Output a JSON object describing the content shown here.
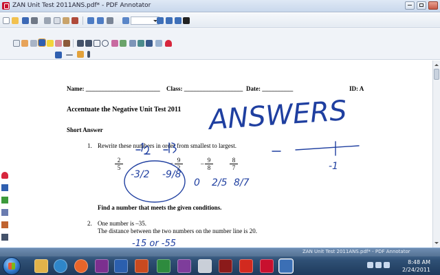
{
  "window": {
    "title": "ZAN Unit Test 2011ANS.pdf* - PDF Annotator"
  },
  "toolbars": {
    "row1_icons": [
      "new-icon",
      "open-icon",
      "save-icon",
      "print-icon",
      "cut-icon",
      "copy-icon",
      "paste-icon",
      "delete-icon",
      "undo-icon",
      "redo-icon",
      "find-icon",
      "zoom-select",
      "page-first-icon",
      "page-prev-icon",
      "page-next-icon",
      "page-last-icon"
    ],
    "row2_icons": [
      "select-icon",
      "hand-icon",
      "zoom-icon",
      "pen-icon",
      "highlighter-icon",
      "eraser-icon",
      "text-icon",
      "stamp-icon",
      "line-icon",
      "arrow-icon",
      "rectangle-icon",
      "ellipse-icon",
      "marker-icon",
      "comment-icon",
      "image-icon",
      "shape-icon",
      "cross-icon",
      "grid-icon",
      "heart-icon"
    ]
  },
  "document": {
    "name_label": "Name: ________________________",
    "class_label": "Class: ___________________",
    "date_label": "Date: __________",
    "id_label": "ID: A",
    "test_title": "Accentuate the Negative Unit Test 2011",
    "section": "Short Answer",
    "q1_num": "1.",
    "q1_text": "Rewrite these numbers in order from smallest to largest.",
    "q1_fractions": [
      {
        "num": "2",
        "den": "5"
      },
      {
        "num": "9",
        "den": "2",
        "neg": true
      },
      {
        "num": "9",
        "den": "8",
        "neg": true
      },
      {
        "num": "8",
        "den": "7"
      }
    ],
    "find_text": "Find a number that meets the given conditions.",
    "q2_num": "2.",
    "q2_line1": "One number is –35.",
    "q2_line2": "The distance between the two numbers on the number line is 20."
  },
  "annotations": {
    "answers_word": "ANSWERS",
    "ordered_list": [
      "-3/2",
      "-9/8",
      "0",
      "2/5",
      "8/7"
    ],
    "numberline_label": "-1",
    "q2_answer": "-15  or  -55"
  },
  "taskbar": {
    "tab_label": "ZAN Unit Test 2011ANS.pdf* - PDF Annotator",
    "clock_time": "8:48 AM",
    "clock_date": "2/24/2011"
  },
  "colors": {
    "ink": "#1f3fa0",
    "title_bar": "#c9d8ec",
    "taskbar": "#2f5075"
  }
}
